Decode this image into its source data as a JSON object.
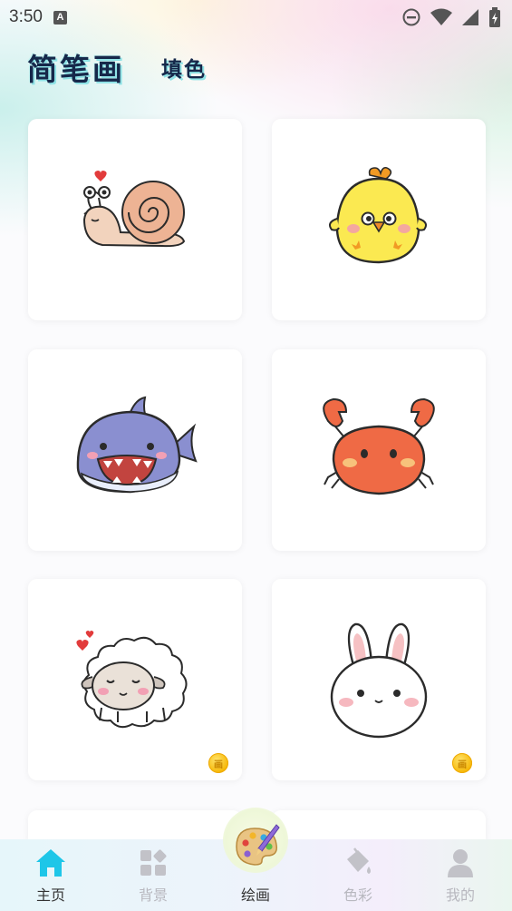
{
  "status_bar": {
    "time": "3:50",
    "notification_letter": "A"
  },
  "header": {
    "title": "简笔画",
    "tab": "填色"
  },
  "cards": [
    {
      "name": "snail",
      "premium": false
    },
    {
      "name": "chick",
      "premium": false
    },
    {
      "name": "shark",
      "premium": false
    },
    {
      "name": "crab",
      "premium": false
    },
    {
      "name": "sheep",
      "premium": true
    },
    {
      "name": "bunny",
      "premium": true
    }
  ],
  "coin_icon": {
    "glyph": "画"
  },
  "bottom_nav": {
    "items": [
      {
        "label": "主页",
        "icon": "home-icon",
        "active": true
      },
      {
        "label": "背景",
        "icon": "grid-icon",
        "active": false
      },
      {
        "label": "绘画",
        "icon": "palette-icon",
        "active": true
      },
      {
        "label": "色彩",
        "icon": "paint-bucket-icon",
        "active": false
      },
      {
        "label": "我的",
        "icon": "person-icon",
        "active": false
      }
    ]
  },
  "colors": {
    "accent": "#1ec6e8",
    "title": "#16284a",
    "inactive": "#b8b8bf"
  }
}
